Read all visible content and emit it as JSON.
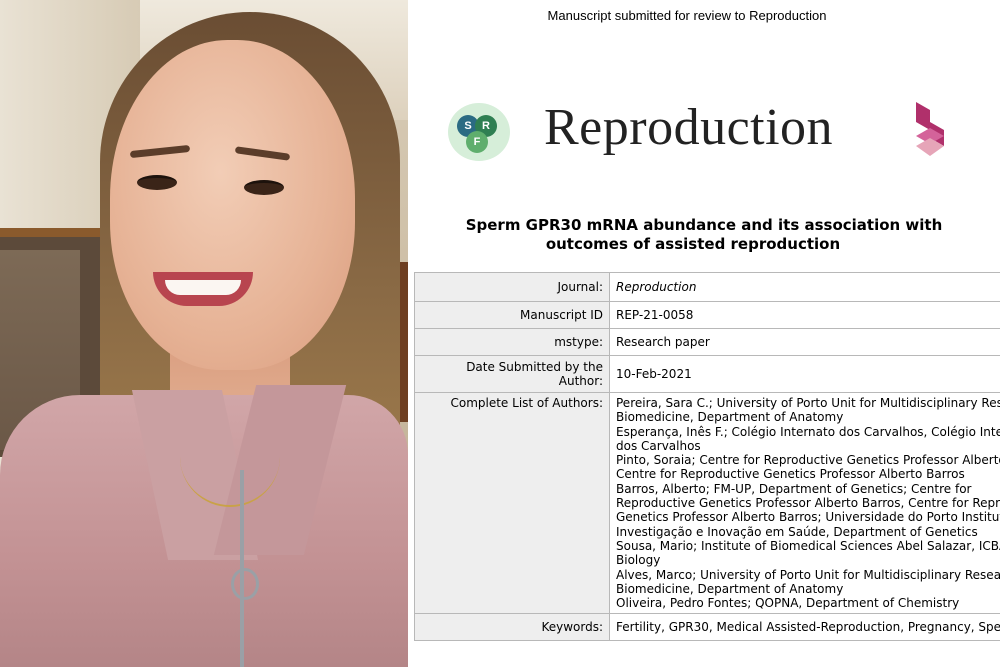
{
  "manuscript": {
    "header_note": "Manuscript submitted for review to Reproduction",
    "journal_logo_letters": [
      "S",
      "R",
      "F"
    ],
    "journal_name": "Reproduction",
    "paper_title_line1": "Sperm GPR30 mRNA abundance and its association with",
    "paper_title_line2": "outcomes of assisted reproduction",
    "fields": {
      "journal_label": "Journal:",
      "journal_value": "Reproduction",
      "manuscript_id_label": "Manuscript ID",
      "manuscript_id_value": "REP-21-0058",
      "mstype_label": "mstype:",
      "mstype_value": "Research paper",
      "date_label": "Date Submitted by the Author:",
      "date_value": "10-Feb-2021",
      "authors_label": "Complete List of Authors:",
      "authors_lines": [
        "Pereira, Sara C.; University of Porto Unit for Multidisciplinary Res",
        "Biomedicine, Department of Anatomy",
        "Esperança, Inês F.; Colégio Internato dos Carvalhos, Colégio Inte",
        "dos Carvalhos",
        "Pinto, Soraia; Centre for Reproductive Genetics Professor Alberto",
        "Centre for Reproductive Genetics Professor Alberto Barros",
        "Barros, Alberto; FM-UP, Department of Genetics; Centre for",
        "Reproductive Genetics Professor Alberto Barros, Centre for Repro",
        "Genetics Professor Alberto Barros; Universidade do Porto Institut",
        "Investigação e Inovação em Saúde, Department of Genetics",
        "Sousa, Mario; Institute of Biomedical Sciences Abel Salazar, ICBA",
        "Biology",
        "Alves, Marco; University of Porto Unit for Multidisciplinary Resea",
        "Biomedicine, Department of Anatomy",
        "Oliveira, Pedro Fontes; QOPNA, Department of Chemistry"
      ],
      "keywords_label": "Keywords:",
      "keywords_value": "Fertility, GPR30, Medical Assisted-Reproduction, Pregnancy, Sper"
    }
  },
  "colors": {
    "label_cell_bg": "#eeeeee",
    "table_border": "#b8b8b8",
    "srf_logo_bg": "#d6eed9",
    "brand_magenta": "#b0306b",
    "brand_pink": "#e6a5b8"
  }
}
